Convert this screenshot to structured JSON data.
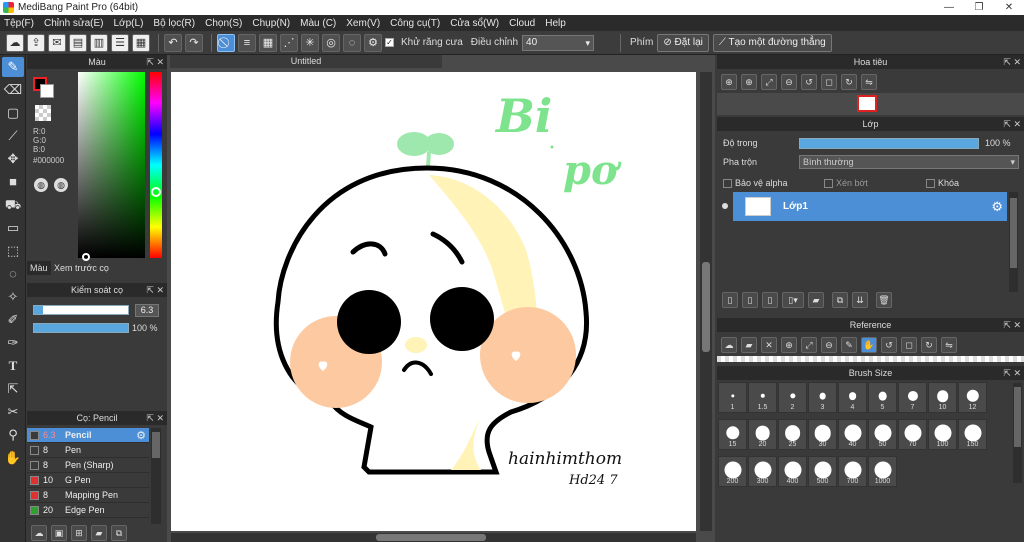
{
  "window": {
    "title": "MediBang Paint Pro (64bit)",
    "minimize": "—",
    "restore": "❐",
    "close": "✕"
  },
  "menu": [
    "Tệp(F)",
    "Chỉnh sửa(E)",
    "Lớp(L)",
    "Bộ lọc(R)",
    "Chọn(S)",
    "Chụp(N)",
    "Màu (C)",
    "Xem(V)",
    "Công cụ(T)",
    "Cửa sổ(W)",
    "Cloud",
    "Help"
  ],
  "toolbar": {
    "antialias_label": "Khử răng cưa",
    "correction_label": "Điều chỉnh",
    "correction_value": "40",
    "snap_label": "Phím",
    "reset_label": "Đặt lại",
    "straight_line_label": "Tạo một đường thẳng"
  },
  "color_panel": {
    "title": "Màu",
    "rgb_r": "R:0",
    "rgb_g": "G:0",
    "rgb_b": "B:0",
    "hex": "#000000",
    "tab_color": "Màu",
    "tab_preview": "Xem trước cọ"
  },
  "brush_control": {
    "title": "Kiểm soát cọ",
    "size_value": "6.3",
    "opacity_value": "100 %",
    "size_fraction": 0.1,
    "opacity_fraction": 1.0
  },
  "brush_list": {
    "title": "Cọ: Pencil",
    "items": [
      {
        "size": "6.3",
        "name": "Pencil",
        "color": "#3a3a3a",
        "selected": true
      },
      {
        "size": "8",
        "name": "Pen",
        "color": "#3a3a3a"
      },
      {
        "size": "8",
        "name": "Pen (Sharp)",
        "color": "#3a3a3a"
      },
      {
        "size": "10",
        "name": "G Pen",
        "color": "#e03030"
      },
      {
        "size": "8",
        "name": "Mapping Pen",
        "color": "#e03030"
      },
      {
        "size": "20",
        "name": "Edge Pen",
        "color": "#30a030"
      }
    ]
  },
  "document": {
    "tab_title": "Untitled"
  },
  "artwork": {
    "title_line1": "Bi",
    "title_line2": "pơ",
    "signature_line1": "hainhimthom",
    "signature_line2": "Hd24 7"
  },
  "navigator": {
    "title": "Hoa tiêu"
  },
  "layer_panel": {
    "title": "Lớp",
    "opacity_label": "Độ trong",
    "opacity_value": "100 %",
    "opacity_fraction": 1.0,
    "blend_label": "Pha trộn",
    "blend_value": "Bình thường",
    "protect_alpha": "Bảo vệ alpha",
    "clipping": "Xén bớt",
    "lock": "Khóa",
    "layer_name": "Lớp1"
  },
  "reference": {
    "title": "Reference"
  },
  "brush_size": {
    "title": "Brush Size",
    "sizes": [
      "1",
      "1.5",
      "2",
      "3",
      "4",
      "5",
      "7",
      "10",
      "12",
      "15",
      "20",
      "25",
      "30",
      "40",
      "50",
      "70",
      "100",
      "150",
      "200",
      "300",
      "400",
      "500",
      "700",
      "1000"
    ]
  },
  "colors": {
    "accent": "#4d8fd6",
    "cheek": "#fcc9a0",
    "leaf": "#8fe6a0",
    "cream": "#fff3b8",
    "title_green": "#7de38d"
  }
}
